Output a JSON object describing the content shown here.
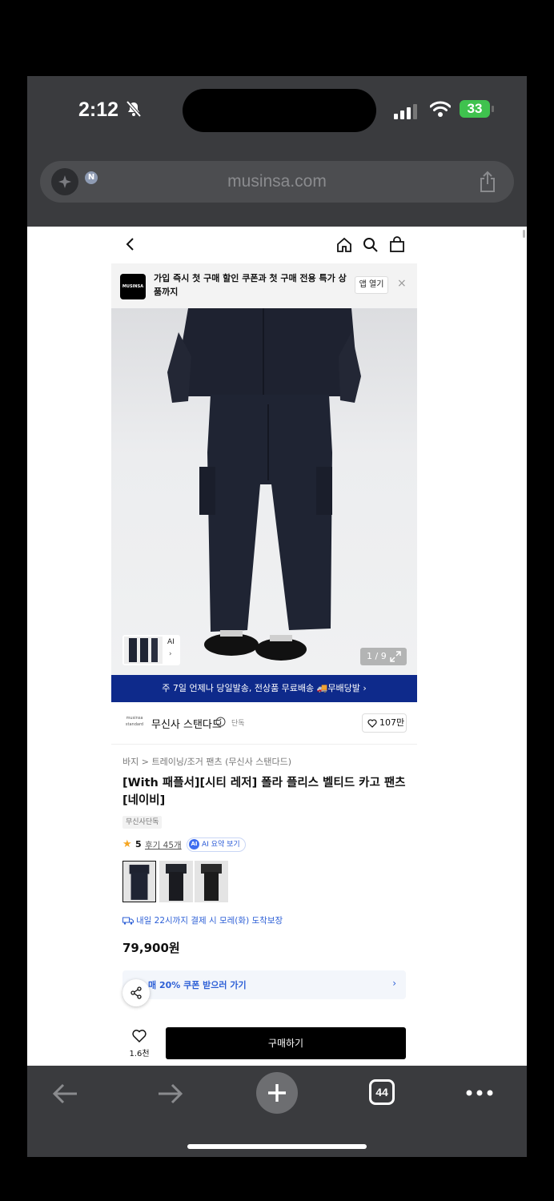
{
  "status": {
    "time": "2:12",
    "battery": "33"
  },
  "browser": {
    "url": "musinsa.com",
    "tab_count": "44",
    "ai_badge": "N"
  },
  "page": {
    "banner": {
      "logo": "MUSINSA",
      "text": "가입 즉시 첫 구매 할인 쿠폰과 첫 구매 전용 특가 상품까지",
      "app_button": "앱 열기",
      "close": "×"
    },
    "gallery": {
      "ai_label": "AI",
      "ai_arrow": "›",
      "counter": "1 / 9"
    },
    "delivery_bar": "주 7일 언제나 당일발송, 전상품 무료배송 🚚무배당발 ›",
    "brand": {
      "logo": "musinsa standard",
      "name": "무신사 스탠다드",
      "tag": "단독",
      "likes": "107만"
    },
    "breadcrumb": "바지 > 트레이닝/조거 팬츠 (무신사 스탠다드)",
    "title": "[With 패플서][시티 레저] 폴라 플리스 벨티드 카고 팬츠 [네이비]",
    "exclusive_tag": "무신사단독",
    "rating": {
      "star": "★",
      "score": "5",
      "reviews": "후기 45개",
      "ai_summary": "AI 요약 보기",
      "ai_icon": "AI"
    },
    "shipping_guarantee": "내일 22시까지 결제 시 모레(화) 도착보장",
    "price": "79,900원",
    "coupon": {
      "text": "매 20% 쿠폰 받으러 가기",
      "arrow": "›"
    },
    "bottom": {
      "wish_count": "1.6천",
      "buy_label": "구매하기"
    }
  }
}
